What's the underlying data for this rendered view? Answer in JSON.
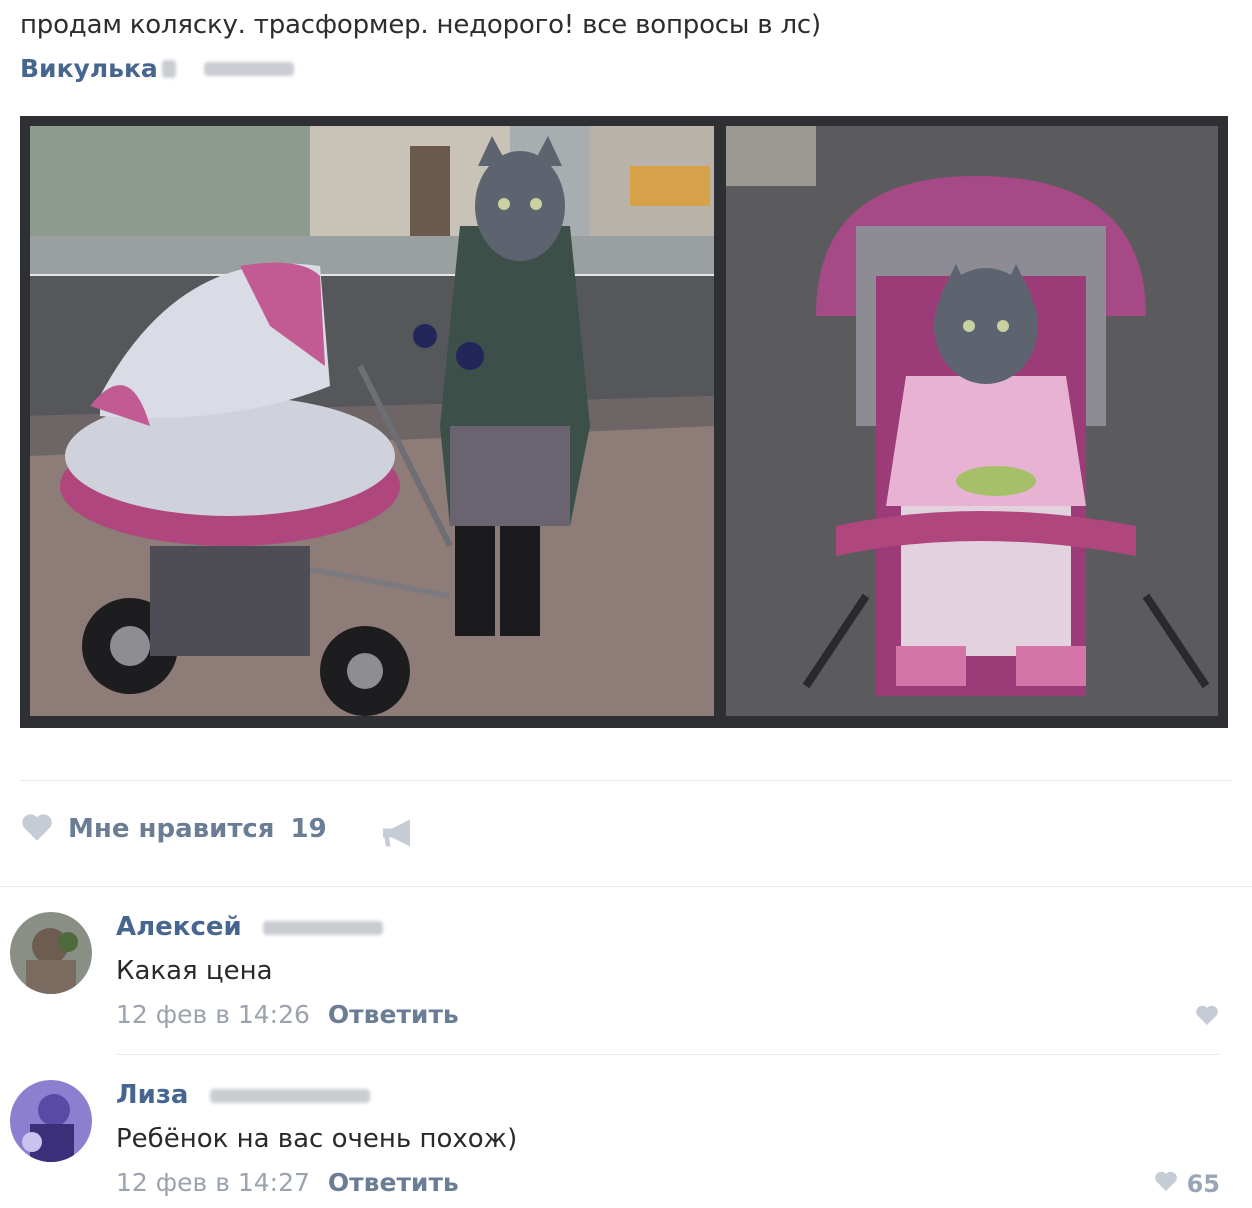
{
  "post": {
    "text": "продам коляску. трасформер. недорого! все вопросы в лс)",
    "author": "Викулька"
  },
  "actions": {
    "like_label": "Мне нравится",
    "like_count": "19",
    "like_icon": "heart-icon",
    "share_icon": "megaphone-icon"
  },
  "comments": [
    {
      "author": "Алексей",
      "text": "Какая цена",
      "date": "12 фев в 14:26",
      "reply": "Ответить",
      "likes": ""
    },
    {
      "author": "Лиза",
      "text": "Ребёнок на вас очень похож)",
      "date": "12 фев в 14:27",
      "reply": "Ответить",
      "likes": "65"
    }
  ],
  "colors": {
    "link": "#47668f",
    "muted": "#9aa3ae",
    "stroller_pink": "#b0467e"
  }
}
